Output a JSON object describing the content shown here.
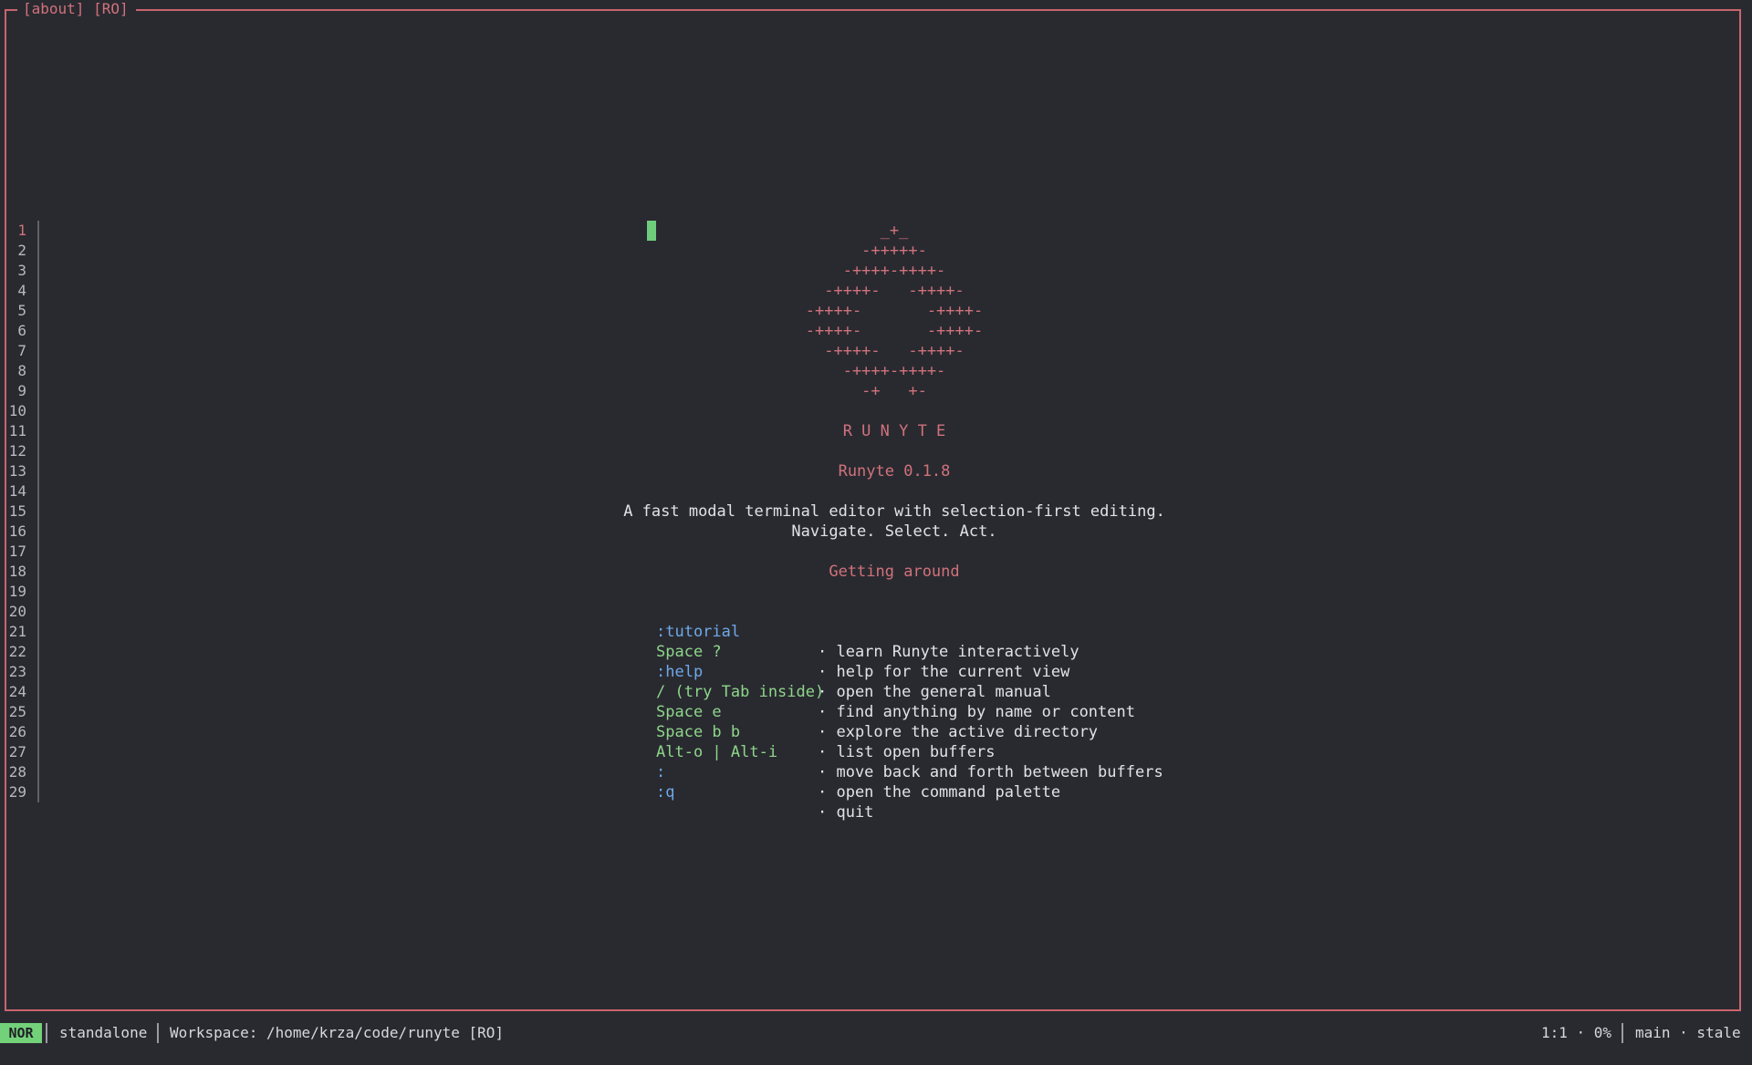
{
  "window": {
    "title": "[about] [RO]"
  },
  "gutter": {
    "line_numbers": [
      "1",
      "2",
      "3",
      "4",
      "5",
      "6",
      "7",
      "8",
      "9",
      "10",
      "11",
      "12",
      "13",
      "14",
      "15",
      "16",
      "17",
      "18",
      "19",
      "20",
      "21",
      "22",
      "23",
      "24",
      "25",
      "26",
      "27",
      "28",
      "29"
    ]
  },
  "logo": {
    "lines": [
      "_+_",
      "-+++++-",
      "-++++-++++-",
      "-++++-   -++++-",
      "-++++-       -++++-",
      "-++++-       -++++-",
      "-++++-   -++++-",
      "-++++-++++-",
      "-+   +-"
    ],
    "wordmark": "R U N Y T E"
  },
  "about": {
    "version": "Runyte 0.1.8",
    "tagline": "A fast modal terminal editor with selection-first editing.",
    "motto": "Navigate. Select. Act.",
    "section_title": "Getting around"
  },
  "bindings": [
    {
      "key": ":tutorial",
      "desc": "· learn Runyte interactively",
      "color": "blue"
    },
    {
      "key": "Space ?",
      "desc": "· help for the current view",
      "color": "green"
    },
    {
      "key": ":help",
      "desc": "· open the general manual",
      "color": "blue"
    },
    {
      "key": "/ (try Tab inside)",
      "desc": "· find anything by name or content",
      "color": "green"
    },
    {
      "key": "Space e",
      "desc": "· explore the active directory",
      "color": "green"
    },
    {
      "key": "Space b b",
      "desc": "· list open buffers",
      "color": "green"
    },
    {
      "key": "Alt-o | Alt-i",
      "desc": "· move back and forth between buffers",
      "color": "green"
    },
    {
      "key": ":",
      "desc": "· open the command palette",
      "color": "blue"
    },
    {
      "key": ":q",
      "desc": "· quit",
      "color": "blue"
    }
  ],
  "statusbar": {
    "mode": "NOR",
    "session": "standalone",
    "workspace": "Workspace: /home/krza/code/runyte [RO]",
    "position": "1:1 · 0%",
    "branch": "main · stale"
  },
  "colors": {
    "accent_red": "#d0727b",
    "key_blue": "#6fa8e8",
    "key_green": "#8ed68a",
    "mode_bg": "#73d17a",
    "background": "#292a30"
  }
}
